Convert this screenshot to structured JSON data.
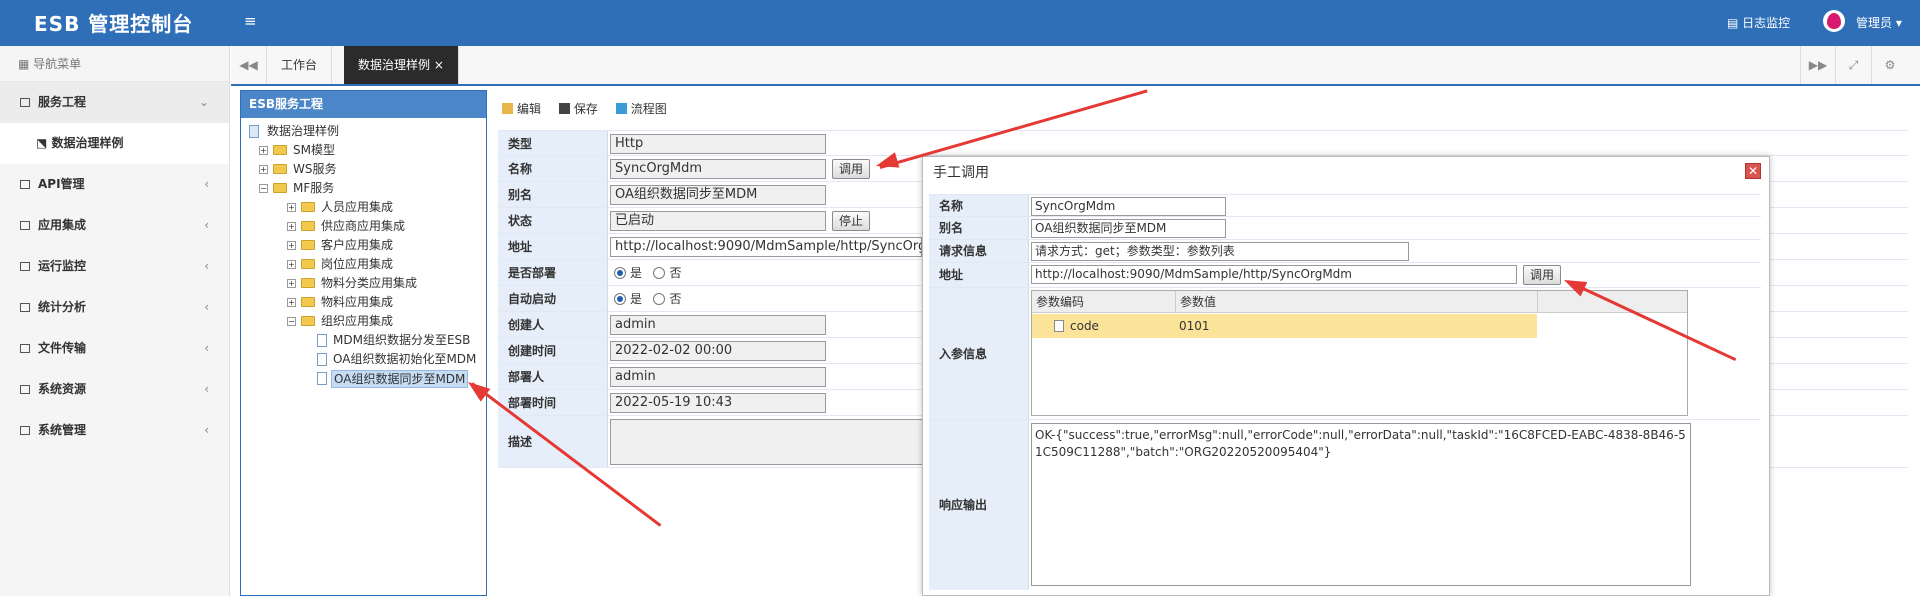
{
  "app": {
    "title": "ESB 管理控制台",
    "menu_toggle": "≡",
    "log_monitor": "日志监控",
    "user": "管理员 ▾"
  },
  "sidebar": {
    "header": "导航菜单",
    "items": [
      {
        "label": "服务工程",
        "arrow": "⌄"
      },
      {
        "label": "数据治理样例",
        "arrow": ""
      },
      {
        "label": "API管理",
        "arrow": "‹"
      },
      {
        "label": "应用集成",
        "arrow": "‹"
      },
      {
        "label": "运行监控",
        "arrow": "‹"
      },
      {
        "label": "统计分析",
        "arrow": "‹"
      },
      {
        "label": "文件传输",
        "arrow": "‹"
      },
      {
        "label": "系统资源",
        "arrow": "‹"
      },
      {
        "label": "系统管理",
        "arrow": "‹"
      }
    ]
  },
  "tabs": {
    "prev": "◀◀",
    "items": [
      "工作台",
      "数据治理样例 ×"
    ],
    "next": "▶▶",
    "fullscreen": "⤢",
    "settings": "⚙"
  },
  "tree": {
    "panel_title": "ESB服务工程",
    "nodes": [
      "数据治理样例",
      "SM模型",
      "WS服务",
      "MF服务",
      "人员应用集成",
      "供应商应用集成",
      "客户应用集成",
      "岗位应用集成",
      "物料分类应用集成",
      "物料应用集成",
      "组织应用集成",
      "MDM组织数据分发至ESB",
      "OA组织数据初始化至MDM",
      "OA组织数据同步至MDM"
    ]
  },
  "toolbar": {
    "edit": "编辑",
    "save": "保存",
    "flow": "流程图"
  },
  "form": {
    "type_label": "类型",
    "type_value": "Http",
    "name_label": "名称",
    "name_value": "SyncOrgMdm",
    "invoke_btn": "调用",
    "alias_label": "别名",
    "alias_value": "OA组织数据同步至MDM",
    "status_label": "状态",
    "status_value": "已启动",
    "stop_btn": "停止",
    "address_label": "地址",
    "address_value": "http://localhost:9090/MdmSample/http/SyncOrgMdm",
    "deploy_label": "是否部署",
    "deploy_yes": "是",
    "deploy_no": "否",
    "autostart_label": "自动启动",
    "autostart_yes": "是",
    "autostart_no": "否",
    "creator_label": "创建人",
    "creator_value": "admin",
    "created_label": "创建时间",
    "created_value": "2022-02-02 00:00",
    "deployer_label": "部署人",
    "deployer_value": "admin",
    "deployed_label": "部署时间",
    "deployed_value": "2022-05-19 10:43",
    "desc_label": "描述"
  },
  "dialog": {
    "title": "手工调用",
    "close": "✕",
    "name_label": "名称",
    "name_value": "SyncOrgMdm",
    "alias_label": "别名",
    "alias_value": "OA组织数据同步至MDM",
    "request_label": "请求信息",
    "request_value": "请求方式：get；参数类型：参数列表",
    "address_label": "地址",
    "address_value": "http://localhost:9090/MdmSample/http/SyncOrgMdm",
    "invoke_btn": "调用",
    "params_label": "入参信息",
    "col_code": "参数编码",
    "col_value": "参数值",
    "param_code": "code",
    "param_value": "0101",
    "response_label": "响应输出",
    "response_value": "OK-{\"success\":true,\"errorMsg\":null,\"errorCode\":null,\"errorData\":null,\"taskId\":\"16C8FCED-EABC-4838-8B46-51C509C11288\",\"batch\":\"ORG20220520095404\"}"
  },
  "colors": {
    "primary": "#2f6fb8",
    "arrow": "#e53935",
    "label_bg": "#e6eff9",
    "selected_row": "#fbe39a"
  }
}
